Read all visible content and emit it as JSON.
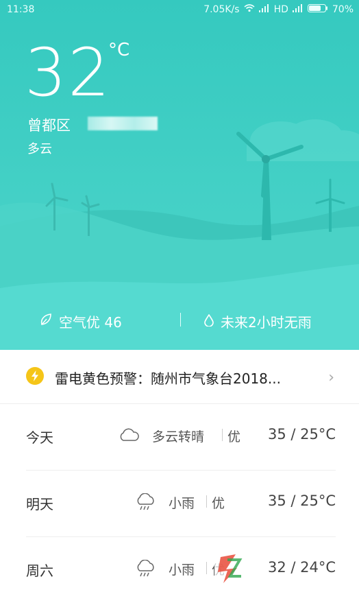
{
  "status_bar": {
    "time": "11:38",
    "speed": "7.05K/s",
    "network": "HD",
    "battery": "70%"
  },
  "current": {
    "temperature": "32",
    "unit": "°C",
    "district": "曾都区",
    "condition": "多云"
  },
  "summary": {
    "air_quality": "空气优 46",
    "rain_forecast": "未来2小时无雨"
  },
  "alert": {
    "text": "雷电黄色预警：随州市气象台2018...",
    "icon": "lightning-icon"
  },
  "forecast": [
    {
      "day": "今天",
      "weather": "多云转晴",
      "aqi": "优",
      "range": "35 / 25°C",
      "icon": "cloud-icon"
    },
    {
      "day": "明天",
      "weather": "小雨",
      "aqi": "优",
      "range": "35 / 25°C",
      "icon": "light-rain-icon"
    },
    {
      "day": "周六",
      "weather": "小雨",
      "aqi": "优",
      "range": "32 / 24°C",
      "icon": "light-rain-icon"
    }
  ],
  "colors": {
    "sky": "#3fcfc4",
    "hill_front": "#52d8cd",
    "hill_back": "#3ec8bd",
    "alert_yellow": "#f5c518"
  }
}
